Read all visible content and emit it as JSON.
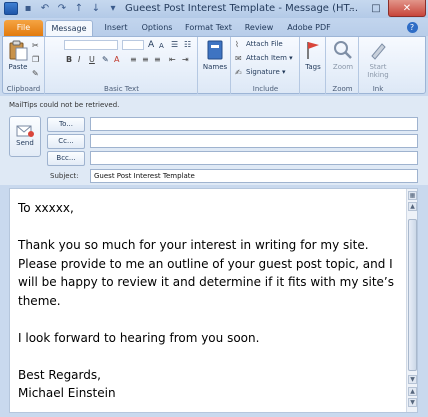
{
  "window": {
    "title": "Gueest Post Interest Template - Message (HT...",
    "min_glyph": "–",
    "max_glyph": "□",
    "close_glyph": "✕"
  },
  "tabs": [
    {
      "label": "File"
    },
    {
      "label": "Message"
    },
    {
      "label": "Insert"
    },
    {
      "label": "Options"
    },
    {
      "label": "Format Text"
    },
    {
      "label": "Review"
    },
    {
      "label": "Adobe PDF"
    }
  ],
  "help_glyph": "?",
  "ribbon": {
    "paste_label": "Paste",
    "clipboard_label": "Clipboard",
    "basic_text_label": "Basic Text",
    "names_label": "Names",
    "attach_file": "Attach File",
    "attach_item": "Attach Item",
    "signature": "Signature",
    "include_label": "Include",
    "tags_label": "Tags",
    "zoom_btn": "Zoom",
    "zoom_label": "Zoom",
    "start_inking": "Start Inking",
    "ink_label": "Ink"
  },
  "mailtips": "MailTips could not be retrieved.",
  "header": {
    "send_label": "Send",
    "to_label": "To...",
    "cc_label": "Cc...",
    "bcc_label": "Bcc...",
    "subject_label": "Subject:",
    "to_value": "",
    "cc_value": "",
    "bcc_value": "",
    "subject_value": "Guest Post Interest Template"
  },
  "body": {
    "greeting": "To xxxxx,",
    "paragraph1": "Thank you so much for your interest in writing for my site. Please provide to me an outline of your guest post topic, and I will be happy to review it and determine if it fits with my site’s theme.",
    "paragraph2": "I look forward to hearing from you soon.",
    "closing": "Best Regards,",
    "signature": "Michael Einstein"
  },
  "colors": {
    "file_tab": "#e27a0d",
    "ribbon_bg": "#dde8f6",
    "close_button": "#c8453b"
  }
}
